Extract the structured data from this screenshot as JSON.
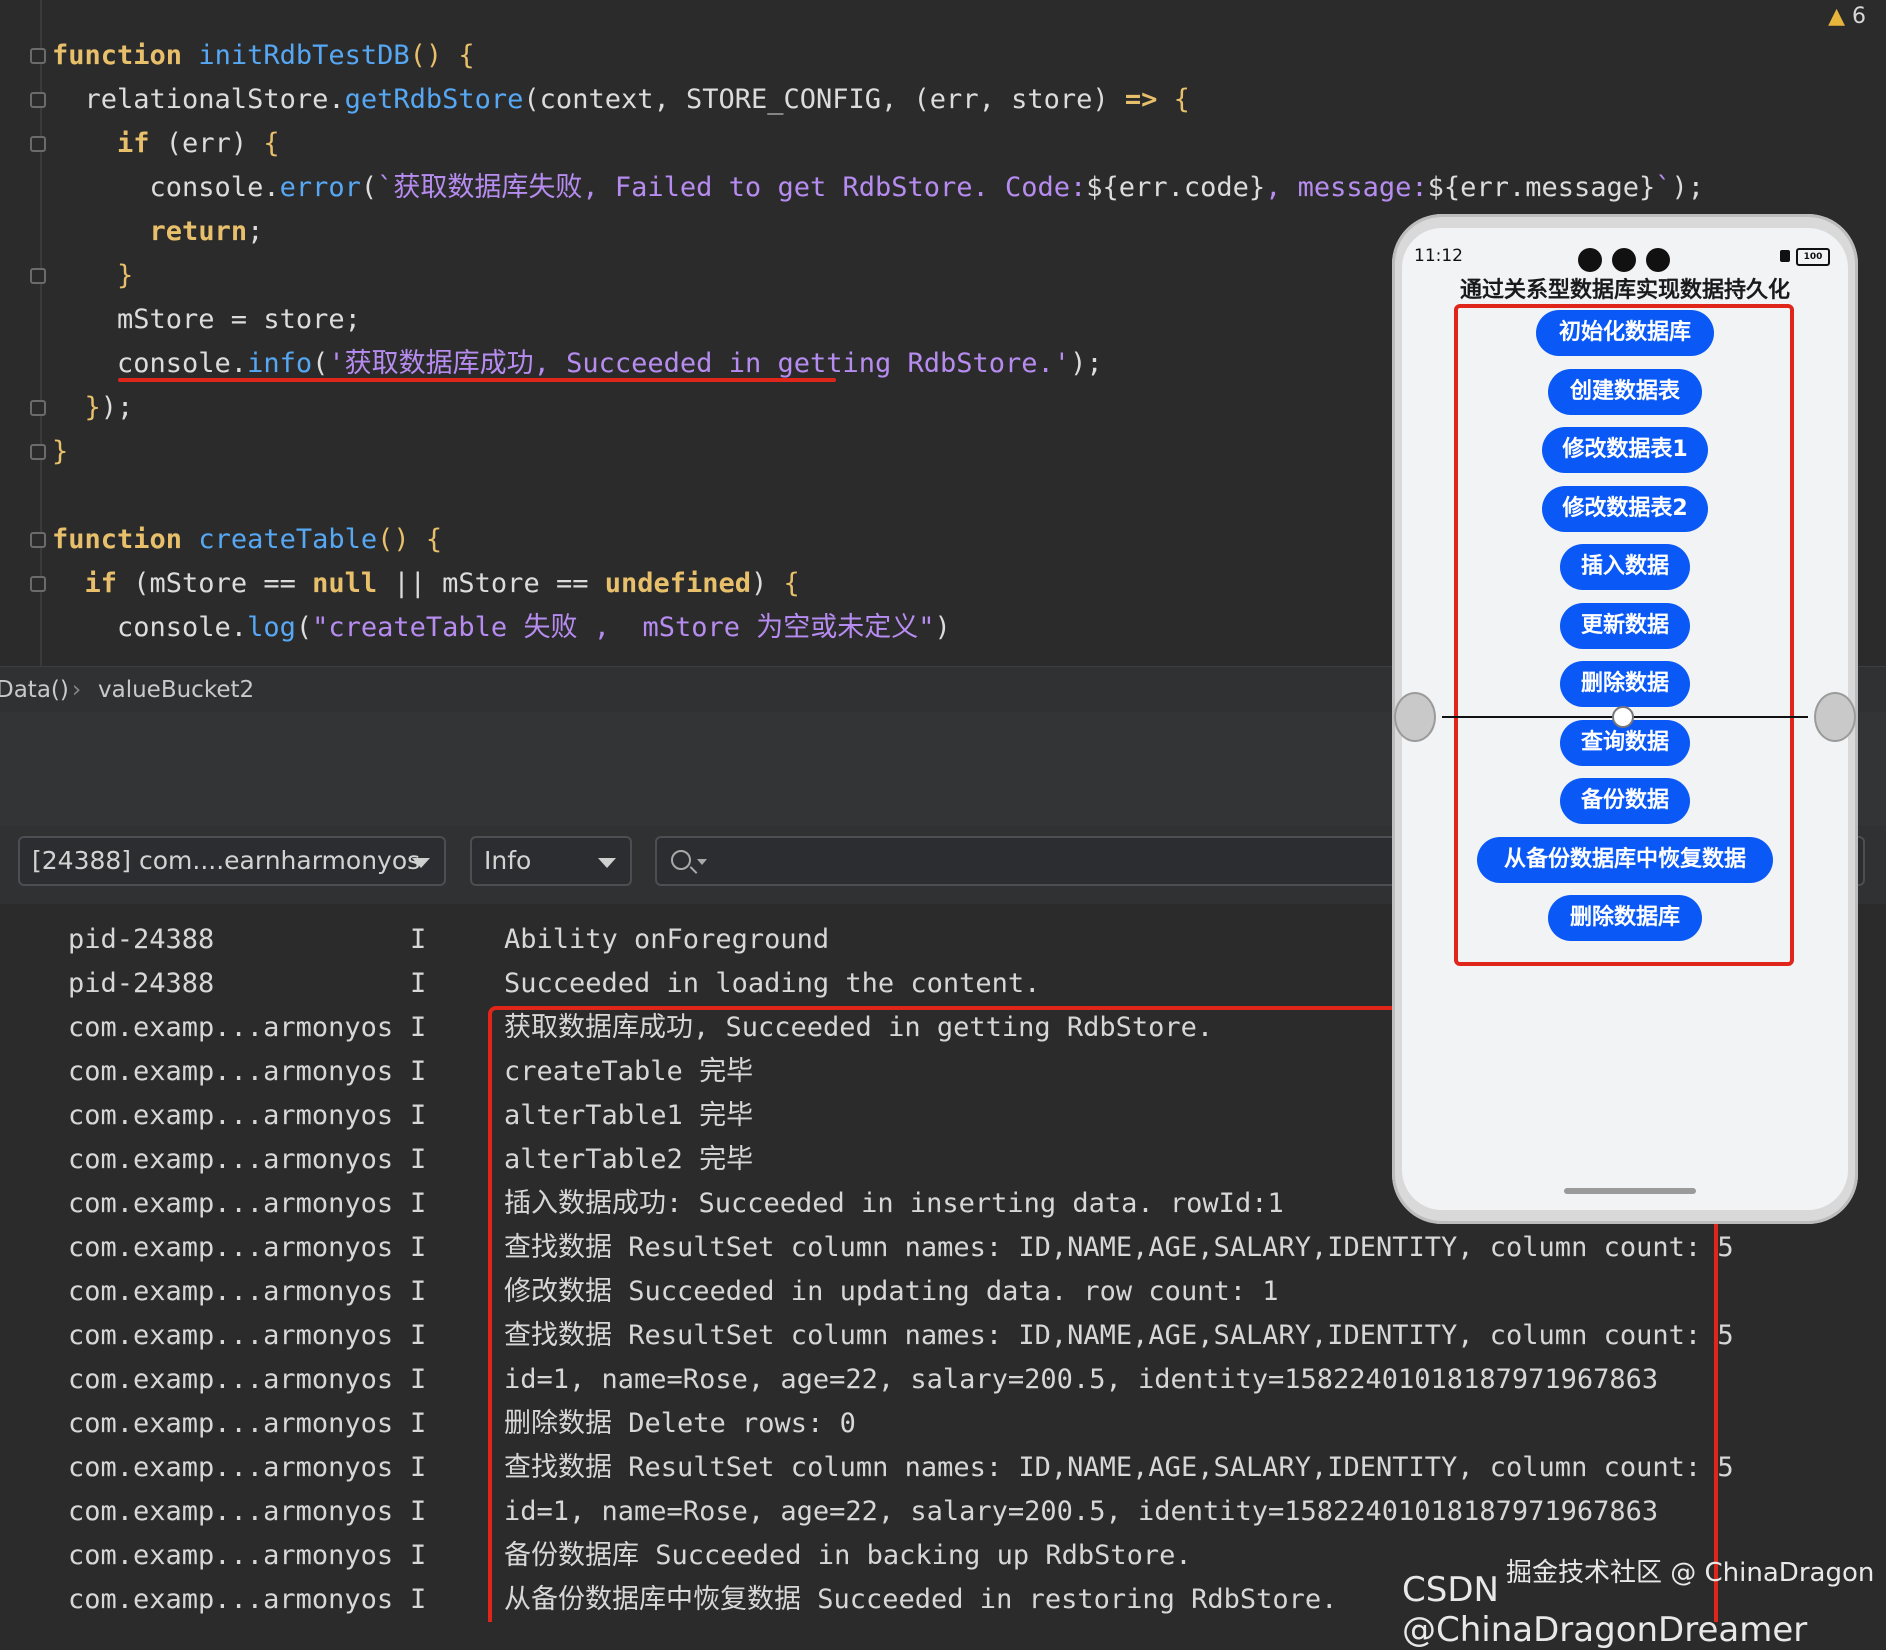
{
  "editor": {
    "warning_count": "6",
    "lines": [
      {
        "html": "<span class='kw'>function</span> <span class='fn'>initRdbTestDB</span><span class='brace'>() {</span>"
      },
      {
        "html": "  relationalStore.<span class='fn'>getRdbStore</span>(context, STORE_CONFIG, (err, store) <span class='kw'>=&gt;</span> <span class='brace'>{</span>"
      },
      {
        "html": "    <span class='kw'>if</span> (err) <span class='brace'>{</span>"
      },
      {
        "html": "      console.<span class='fn'>error</span>(<span class='str'>`获取数据库失败, Failed to get RdbStore. Code:</span>${err.code}<span class='str'>, message:</span>${err.message}<span class='str'>`</span>);"
      },
      {
        "html": "      <span class='kw'>return</span>;"
      },
      {
        "html": "    <span class='brace'>}</span>"
      },
      {
        "html": "    mStore = store;"
      },
      {
        "html": "    console.<span class='fn'>info</span>(<span class='str'>'获取数据库成功, Succeeded in getting RdbStore.'</span>);"
      },
      {
        "html": "  <span class='brace'>}</span>);"
      },
      {
        "html": "<span class='brace'>}</span>"
      },
      {
        "html": ""
      },
      {
        "html": "<span class='kw'>function</span> <span class='fn'>createTable</span><span class='brace'>() {</span>"
      },
      {
        "html": "  <span class='kw'>if</span> (mStore == <span class='kw'>null</span> || mStore == <span class='kw'>undefined</span>) <span class='brace'>{</span>"
      },
      {
        "html": "    console.<span class='fn'>log</span>(<span class='str'>\"createTable 失败 ,  mStore 为空或未定义\"</span>)"
      }
    ]
  },
  "breadcrumb": {
    "item1": "Data()",
    "separator": "›",
    "item2": "valueBucket2"
  },
  "filters": {
    "process": "[24388] com....earnharmonyos",
    "level": "Info",
    "search_placeholder": ""
  },
  "log": {
    "rows": [
      {
        "tag": "pid-24388",
        "level": "I",
        "msg": "Ability onForeground"
      },
      {
        "tag": "pid-24388",
        "level": "I",
        "msg": "Succeeded in loading the content."
      },
      {
        "tag": "com.examp...armonyos",
        "level": "I",
        "msg": "获取数据库成功, Succeeded in getting RdbStore."
      },
      {
        "tag": "com.examp...armonyos",
        "level": "I",
        "msg": "createTable 完毕"
      },
      {
        "tag": "com.examp...armonyos",
        "level": "I",
        "msg": "alterTable1 完毕"
      },
      {
        "tag": "com.examp...armonyos",
        "level": "I",
        "msg": "alterTable2 完毕"
      },
      {
        "tag": "com.examp...armonyos",
        "level": "I",
        "msg": "插入数据成功: Succeeded in inserting data. rowId:1"
      },
      {
        "tag": "com.examp...armonyos",
        "level": "I",
        "msg": "查找数据 ResultSet column names: ID,NAME,AGE,SALARY,IDENTITY, column count: 5"
      },
      {
        "tag": "com.examp...armonyos",
        "level": "I",
        "msg": "修改数据 Succeeded in updating data. row count: 1"
      },
      {
        "tag": "com.examp...armonyos",
        "level": "I",
        "msg": "查找数据 ResultSet column names: ID,NAME,AGE,SALARY,IDENTITY, column count: 5"
      },
      {
        "tag": "com.examp...armonyos",
        "level": "I",
        "msg": "id=1, name=Rose, age=22, salary=200.5, identity=1582240101818797196786З"
      },
      {
        "tag": "com.examp...armonyos",
        "level": "I",
        "msg": "删除数据 Delete rows: 0"
      },
      {
        "tag": "com.examp...armonyos",
        "level": "I",
        "msg": "查找数据 ResultSet column names: ID,NAME,AGE,SALARY,IDENTITY, column count: 5"
      },
      {
        "tag": "com.examp...armonyos",
        "level": "I",
        "msg": "id=1, name=Rose, age=22, salary=200.5, identity=15822401018187971967863"
      },
      {
        "tag": "com.examp...armonyos",
        "level": "I",
        "msg": "备份数据库 Succeeded in backing up RdbStore."
      },
      {
        "tag": "com.examp...armonyos",
        "level": "I",
        "msg": "从备份数据库中恢复数据 Succeeded in restoring RdbStore."
      }
    ]
  },
  "phone": {
    "time": "11:12",
    "battery": "100",
    "title": "通过关系型数据库实现数据持久化",
    "buttons": [
      {
        "label": "初始化数据库"
      },
      {
        "label": "创建数据表"
      },
      {
        "label": "修改数据表1"
      },
      {
        "label": "修改数据表2"
      },
      {
        "label": "插入数据"
      },
      {
        "label": "更新数据"
      },
      {
        "label": "删除数据"
      },
      {
        "label": "查询数据"
      },
      {
        "label": "备份数据"
      },
      {
        "label": "从备份数据库中恢复数据"
      },
      {
        "label": "删除数据库"
      }
    ],
    "button_color": "#0a59f7"
  },
  "watermark": {
    "line1": "掘金技术社区 @ ChinaDragon",
    "line2": "CSDN @ChinaDragonDreamer"
  },
  "colors": {
    "highlight_red": "#e0251b",
    "editor_bg": "#2b2b2b"
  }
}
